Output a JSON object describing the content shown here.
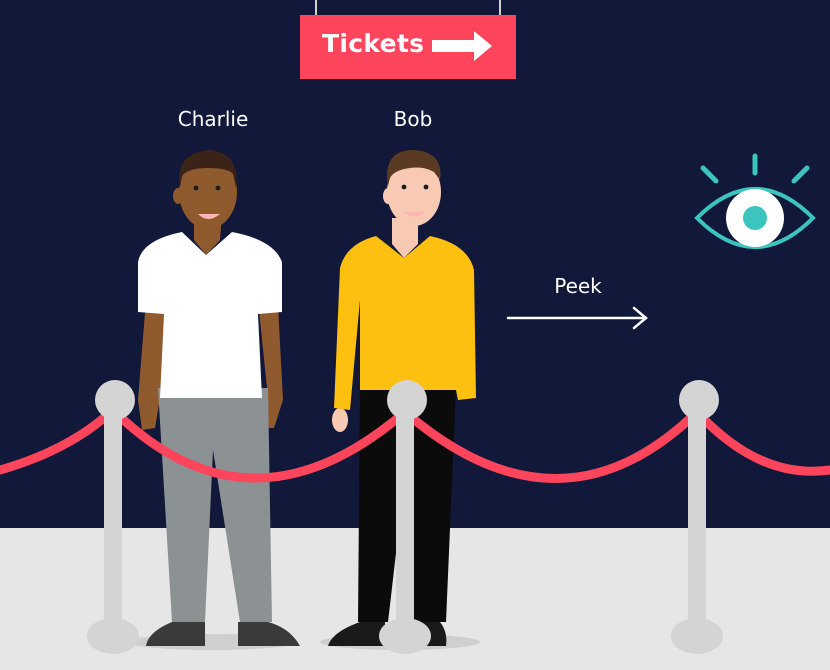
{
  "sign": {
    "label": "Tickets"
  },
  "people": [
    {
      "name": "Charlie"
    },
    {
      "name": "Bob"
    }
  ],
  "arrow": {
    "label": "Peek"
  },
  "icons": {
    "eye": "eye-icon",
    "sign_arrow": "arrow-right-icon"
  },
  "colors": {
    "background": "#11183a",
    "floor": "#e6e6e6",
    "sign": "#ff455c",
    "rope": "#ff455c",
    "post": "#dcdcdc",
    "eye_accent": "#3cc5be",
    "charlie_shirt": "#ffffff",
    "charlie_pants": "#8c9194",
    "bob_shirt": "#fdbf10",
    "bob_pants": "#0b0b0b"
  }
}
